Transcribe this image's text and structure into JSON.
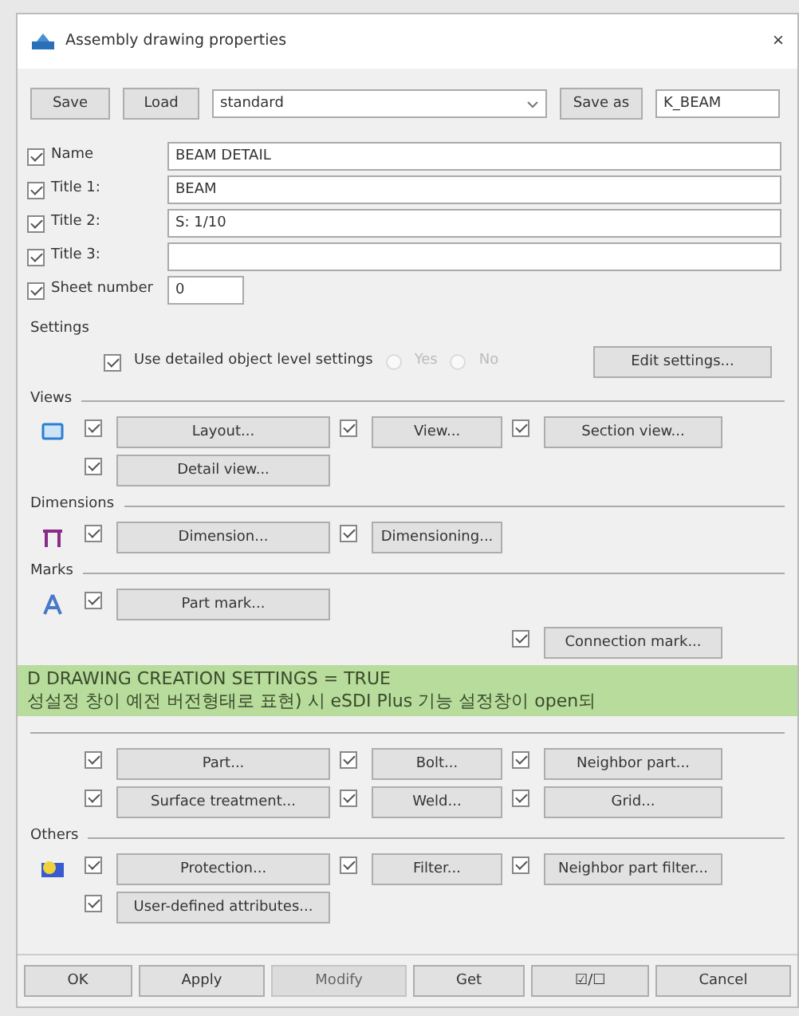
{
  "window": {
    "title": "Assembly drawing properties",
    "close": "×"
  },
  "toolbar": {
    "save": "Save",
    "load": "Load",
    "standard": "standard",
    "save_as": "Save as",
    "save_as_name": "K_BEAM"
  },
  "fields": [
    {
      "label": "Name",
      "checked": true,
      "value": "BEAM DETAIL"
    },
    {
      "label": "Title 1:",
      "checked": true,
      "value": "BEAM"
    },
    {
      "label": "Title 2:",
      "checked": true,
      "value": "S: 1/10"
    },
    {
      "label": "Title 3:",
      "checked": true
    },
    {
      "label": "Sheet number",
      "checked": true,
      "value": "0"
    }
  ],
  "settings": {
    "title": "Settings",
    "checkbox": {
      "label": "Use detailed object level settings",
      "checked": true
    },
    "radios": [
      {
        "label": "Yes",
        "selected": false,
        "disabled": true
      },
      {
        "label": "No",
        "selected": false,
        "disabled": true
      }
    ],
    "edit": "Edit settings..."
  },
  "sections": [
    {
      "title": "Views",
      "rows": [
        [
          {
            "label": "Layout...",
            "checked": true
          },
          {
            "label": "View...",
            "checked": true
          },
          {
            "label": "Section view...",
            "checked": true
          }
        ],
        [
          {
            "label": "Detail view...",
            "checked": true
          }
        ]
      ]
    },
    {
      "title": "Dimensions",
      "rows": [
        [
          {
            "label": "Dimension...",
            "checked": true
          },
          {
            "label": "Dimensioning...",
            "checked": true
          }
        ]
      ]
    },
    {
      "title": "Marks",
      "rows": [
        [
          {
            "label": "Part mark...",
            "checked": true
          }
        ],
        [
          null,
          null,
          {
            "label": "Connection mark...",
            "checked": true
          }
        ]
      ]
    },
    {
      "rows": [
        [
          {
            "label": "Part...",
            "checked": true
          },
          {
            "label": "Bolt...",
            "checked": true
          },
          {
            "label": "Neighbor part...",
            "checked": true
          }
        ],
        [
          {
            "label": "Surface treatment...",
            "checked": true
          },
          {
            "label": "Weld...",
            "checked": true
          },
          {
            "label": "Grid...",
            "checked": true
          }
        ]
      ]
    },
    {
      "title": "Others",
      "rows": [
        [
          {
            "label": "Protection...",
            "checked": true
          },
          {
            "label": "Filter...",
            "checked": true
          },
          {
            "label": "Neighbor part filter...",
            "checked": true
          }
        ],
        [
          {
            "label": "User-defined attributes...",
            "checked": true
          }
        ]
      ]
    }
  ],
  "footer": [
    {
      "label": "OK",
      "disabled": false
    },
    {
      "label": "Apply",
      "disabled": false
    },
    {
      "label": "Modify",
      "disabled": true
    },
    {
      "label": "Get",
      "disabled": false
    },
    {
      "label": "☑/☐",
      "disabled": false
    },
    {
      "label": "Cancel",
      "disabled": false
    }
  ],
  "annotation": {
    "lines": [
      "D DRAWING CREATION SETTINGS = TRUE",
      "성설정 창이 예전 버전형태로 표현) 시 eSDI Plus 기능 설정창이 open되"
    ]
  }
}
